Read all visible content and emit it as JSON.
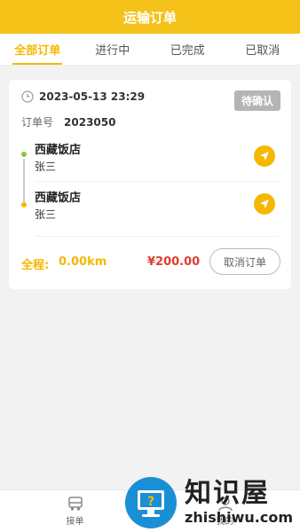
{
  "header": {
    "title": "运输订单"
  },
  "tabs": [
    {
      "label": "全部订单",
      "active": true
    },
    {
      "label": "进行中",
      "active": false
    },
    {
      "label": "已完成",
      "active": false
    },
    {
      "label": "已取消",
      "active": false
    }
  ],
  "order": {
    "time": "2023-05-13 23:29",
    "status": "待确认",
    "order_label": "订单号",
    "order_no": "2023050",
    "stops": [
      {
        "name": "西藏饭店",
        "contact": "张三",
        "dot_color": "#8cc63f"
      },
      {
        "name": "西藏饭店",
        "contact": "张三",
        "dot_color": "#f5b800"
      }
    ],
    "distance_label": "全程:",
    "distance_value": "0.00km",
    "price": "¥200.00",
    "cancel_label": "取消订单"
  },
  "bottom_nav": [
    {
      "label": "接单",
      "icon": "truck-icon"
    },
    {
      "label": "我的",
      "icon": "user-icon"
    }
  ],
  "watermark": {
    "cn": "知识屋",
    "en": "zhishiwu.com"
  },
  "colors": {
    "accent": "#f5c21a",
    "price": "#e03c31",
    "status_badge": "#b5b5b5"
  }
}
